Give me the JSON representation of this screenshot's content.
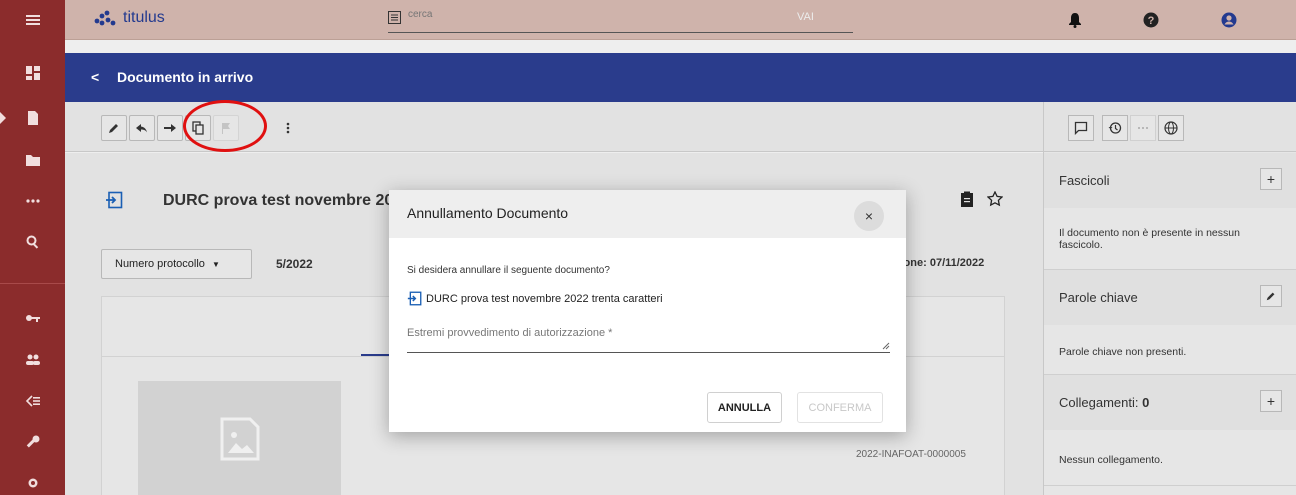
{
  "app": {
    "name": "titulus"
  },
  "search": {
    "placeholder": "cerca",
    "go_label": "VAI"
  },
  "header": {
    "back_label": "<",
    "title": "Documento in arrivo"
  },
  "document": {
    "title": "DURC prova test novembre 20",
    "protocol_select_label": "Numero protocollo",
    "protocol_value": "5/2022",
    "date_label": "zione: 07/11/2022",
    "code": "2022-INAFOAT-0000005"
  },
  "right_panel": {
    "fascicoli": {
      "title": "Fascicoli",
      "body": "Il documento non è presente in nessun fascicolo."
    },
    "parole_chiave": {
      "title": "Parole chiave",
      "body": "Parole chiave non presenti."
    },
    "collegamenti": {
      "title_prefix": "Collegamenti: ",
      "count": "0",
      "body": "Nessun collegamento."
    }
  },
  "modal": {
    "title": "Annullamento Documento",
    "question": "Si desidera annullare il seguente documento?",
    "document_name": "DURC prova test novembre 2022 trenta caratteri",
    "field_label": "Estremi provvedimento di autorizzazione *",
    "cancel_label": "ANNULLA",
    "confirm_label": "CONFERMA"
  },
  "colors": {
    "rail": "#8b2c2c",
    "topbar": "#cfb3ab",
    "header": "#2a3c8c",
    "annotation": "#e01010",
    "accent_icon": "#1a5fb4"
  }
}
